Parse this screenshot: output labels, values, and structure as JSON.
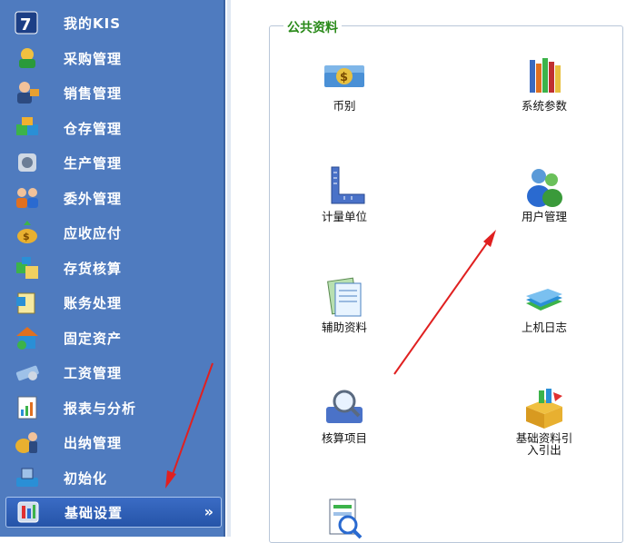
{
  "sidebar": {
    "items": [
      {
        "label": "我的KIS",
        "icon": "kis-logo-icon"
      },
      {
        "label": "采购管理",
        "icon": "purchase-icon"
      },
      {
        "label": "销售管理",
        "icon": "sales-icon"
      },
      {
        "label": "仓存管理",
        "icon": "warehouse-icon"
      },
      {
        "label": "生产管理",
        "icon": "production-icon"
      },
      {
        "label": "委外管理",
        "icon": "outsourcing-icon"
      },
      {
        "label": "应收应付",
        "icon": "receivable-payable-icon"
      },
      {
        "label": "存货核算",
        "icon": "inventory-accounting-icon"
      },
      {
        "label": "账务处理",
        "icon": "ledger-icon"
      },
      {
        "label": "固定资产",
        "icon": "fixed-assets-icon"
      },
      {
        "label": "工资管理",
        "icon": "payroll-icon"
      },
      {
        "label": "报表与分析",
        "icon": "report-icon"
      },
      {
        "label": "出纳管理",
        "icon": "cashier-icon"
      },
      {
        "label": "初始化",
        "icon": "initialize-icon"
      },
      {
        "label": "基础设置",
        "icon": "basic-settings-icon",
        "active": true
      }
    ],
    "expand_glyph": "»"
  },
  "panel": {
    "title": "公共资料",
    "tiles": [
      {
        "label": "币别",
        "icon": "currency-icon"
      },
      {
        "label": "系统参数",
        "icon": "system-params-icon"
      },
      {
        "label": "计量单位",
        "icon": "measure-unit-icon"
      },
      {
        "label": "用户管理",
        "icon": "user-management-icon"
      },
      {
        "label": "辅助资料",
        "icon": "auxiliary-data-icon"
      },
      {
        "label": "上机日志",
        "icon": "operation-log-icon"
      },
      {
        "label": "核算项目",
        "icon": "accounting-item-icon"
      },
      {
        "label": "基础资料引入引出",
        "icon": "data-import-export-icon"
      },
      {
        "label": "",
        "icon": "report-search-icon"
      }
    ]
  },
  "colors": {
    "sidebar_bg": "#4f7bbf",
    "active_bg": "#2554a8",
    "panel_title": "#2a8a1a",
    "arrow": "#e02020"
  }
}
